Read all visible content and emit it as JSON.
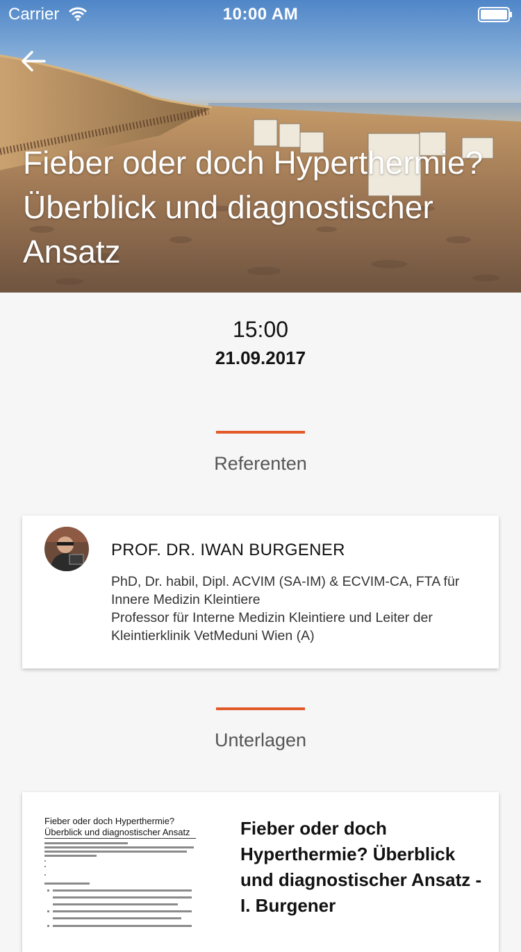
{
  "status_bar": {
    "carrier": "Carrier",
    "time": "10:00 AM",
    "wifi_icon": "wifi-icon",
    "battery_icon": "battery-icon"
  },
  "header": {
    "back_icon": "arrow-left-icon",
    "title": "Fieber oder doch Hyperthermie? Überblick und diagnostischer Ansatz"
  },
  "session": {
    "time": "15:00",
    "date": "21.09.2017"
  },
  "speakers_section": {
    "title": "Referenten",
    "accent_color": "#e2592a",
    "speakers": [
      {
        "name": "PROF. DR. IWAN BURGENER",
        "bio_lines": [
          "PhD, Dr. habil, Dipl. ACVIM (SA-IM) & ECVIM-CA, FTA für",
          "Innere Medizin Kleintiere",
          "Professor für Interne Medizin Kleintiere und Leiter der",
          "Kleintierklinik VetMeduni Wien (A)"
        ]
      }
    ]
  },
  "documents_section": {
    "title": "Unterlagen",
    "documents": [
      {
        "thumbnail_title_lines": [
          "Fieber oder doch Hyperthermie?",
          "Überblick und diagnostischer Ansatz"
        ],
        "title": "Fieber oder doch Hyperthermie? Überblick und diagnostischer Ansatz - I. Burgener"
      }
    ]
  }
}
